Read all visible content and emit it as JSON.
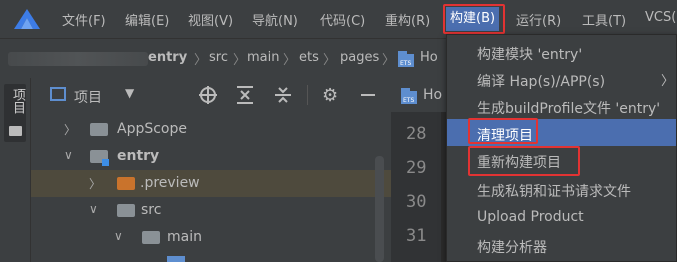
{
  "menubar": {
    "items": [
      "文件(F)",
      "编辑(E)",
      "视图(V)",
      "导航(N)",
      "代码(C)",
      "重构(R)",
      "构建(B)",
      "运行(R)",
      "工具(T)",
      "VCS("
    ]
  },
  "breadcrumb": {
    "items": [
      "entry",
      "src",
      "main",
      "ets",
      "pages",
      "Ho"
    ]
  },
  "left_strip": {
    "label": "项目"
  },
  "project_toolbar": {
    "label": "项目"
  },
  "tree": {
    "items": [
      "AppScope",
      "entry",
      ".preview",
      "src",
      "main"
    ]
  },
  "editor": {
    "tab_label": "Ho",
    "line_numbers": [
      "28",
      "29",
      "30",
      "31"
    ]
  },
  "build_menu": {
    "items": [
      "构建模块 'entry'",
      "编译 Hap(s)/APP(s)",
      "生成buildProfile文件 'entry'",
      "清理项目",
      "重新构建项目",
      "生成私钥和证书请求文件",
      "Upload Product",
      "构建分析器"
    ]
  },
  "colors": {
    "accent": "#4b6eaf",
    "highlight_box": "#e23333",
    "panel": "#3c3f41",
    "editor_bg": "#2b2b2b"
  }
}
